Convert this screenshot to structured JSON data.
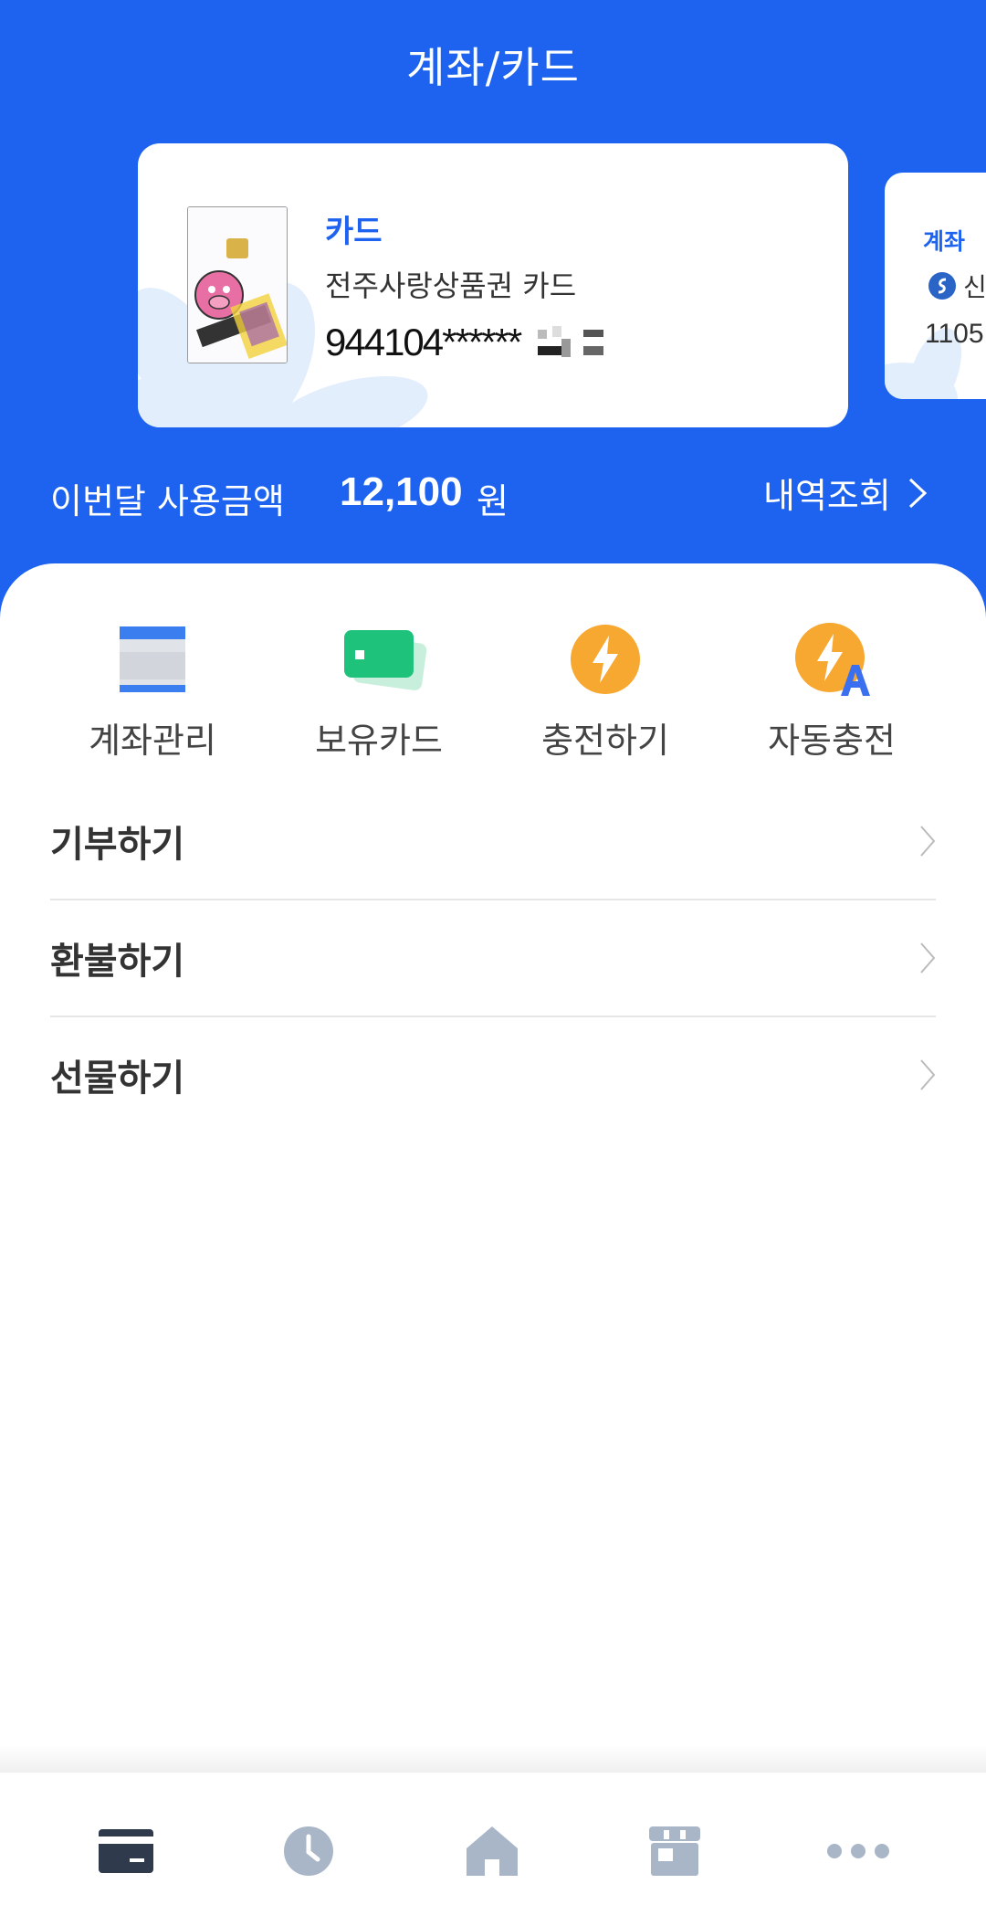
{
  "header": {
    "title": "계좌/카드"
  },
  "cards": [
    {
      "type": "카드",
      "name": "전주사랑상품권 카드",
      "number": "944104******",
      "thumbnail": "pig-card-image"
    },
    {
      "type": "계좌",
      "bank": "신",
      "number": "1105"
    }
  ],
  "usage": {
    "label": "이번달 사용금액",
    "amount": "12,100",
    "unit": "원",
    "history_label": "내역조회"
  },
  "quick_actions": [
    {
      "label": "계좌관리",
      "icon": "account-icon"
    },
    {
      "label": "보유카드",
      "icon": "card-icon"
    },
    {
      "label": "충전하기",
      "icon": "lightning-icon"
    },
    {
      "label": "자동충전",
      "icon": "auto-charge-icon"
    }
  ],
  "menu": [
    {
      "label": "기부하기"
    },
    {
      "label": "환불하기"
    },
    {
      "label": "선물하기"
    }
  ],
  "bottom_nav": [
    {
      "icon": "card-icon",
      "active": true
    },
    {
      "icon": "clock-icon",
      "active": false
    },
    {
      "icon": "home-icon",
      "active": false
    },
    {
      "icon": "store-icon",
      "active": false
    },
    {
      "icon": "more-icon",
      "active": false
    }
  ],
  "colors": {
    "primary": "#1d63ef",
    "accent_orange": "#f7a830",
    "green": "#1fc27a",
    "nav_active": "#2f3b4c",
    "nav_inactive": "#a9b6c8"
  }
}
